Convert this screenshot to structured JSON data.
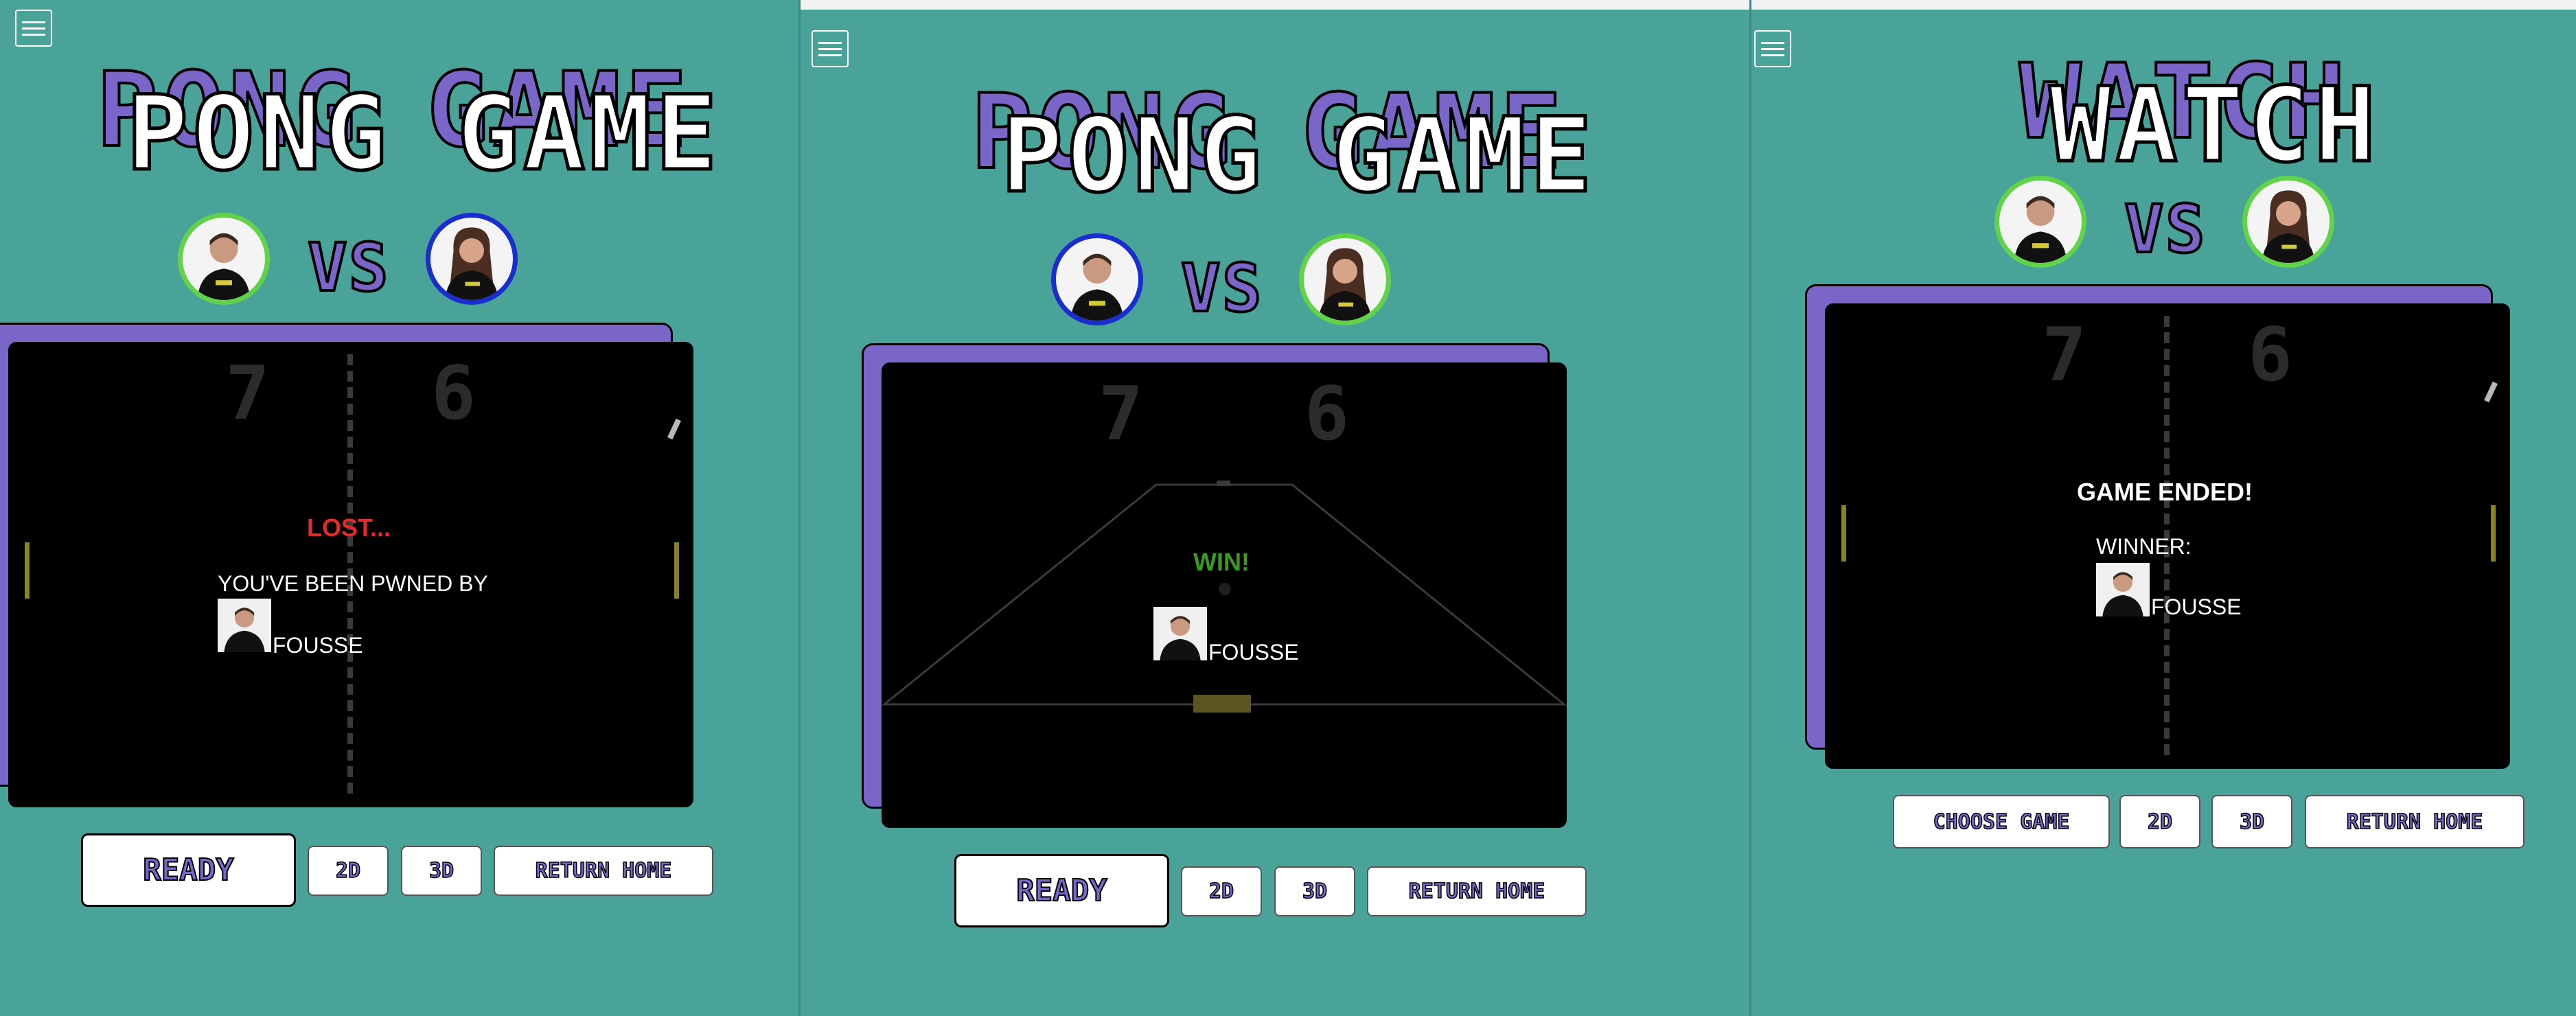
{
  "panels": [
    {
      "title": "PONG GAME",
      "vs": "VS",
      "scores": {
        "left": "7",
        "right": "6"
      },
      "message": {
        "status": "LOST...",
        "line": "YOU'VE BEEN PWNED BY",
        "player": "FOUSSE"
      },
      "buttons": {
        "ready": "READY",
        "mode_2d": "2D",
        "mode_3d": "3D",
        "home": "RETURN HOME"
      }
    },
    {
      "title": "PONG GAME",
      "vs": "VS",
      "scores": {
        "left": "7",
        "right": "6"
      },
      "message": {
        "status": "WIN!",
        "player": "FOUSSE"
      },
      "buttons": {
        "ready": "READY",
        "mode_2d": "2D",
        "mode_3d": "3D",
        "home": "RETURN HOME"
      }
    },
    {
      "title": "WATCH",
      "vs": "VS",
      "scores": {
        "left": "7",
        "right": "6"
      },
      "message": {
        "status": "GAME ENDED!",
        "winner_label": "WINNER:",
        "player": "FOUSSE"
      },
      "buttons": {
        "choose": "CHOOSE GAME",
        "mode_2d": "2D",
        "mode_3d": "3D",
        "home": "RETURN HOME"
      }
    }
  ],
  "colors": {
    "background": "#4aa399",
    "accent_purple": "#7a66c9",
    "ring_green": "#62d24a",
    "ring_blue": "#1a2ed0",
    "lost_red": "#e02b2b",
    "win_green": "#3c9a23",
    "paddle": "#8a8226"
  },
  "icons": {
    "menu": "hamburger-menu-icon"
  }
}
